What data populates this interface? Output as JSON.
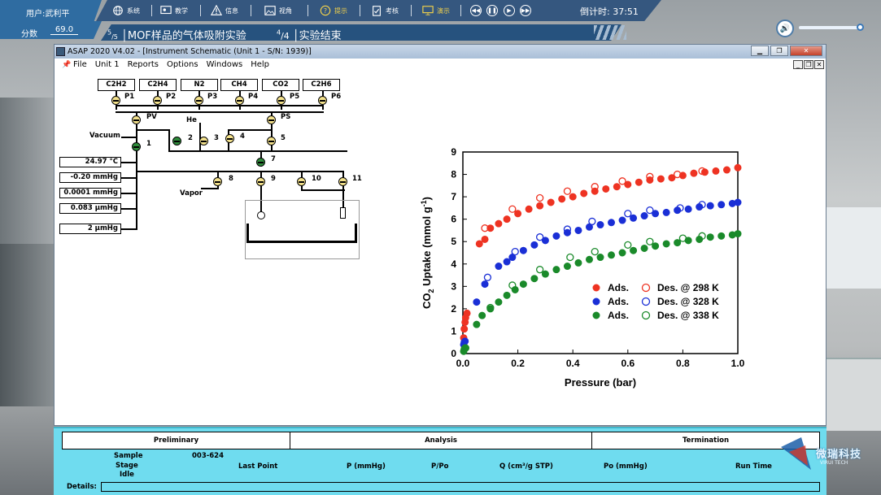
{
  "topbar": {
    "user_label": "用户:武利平",
    "score_label": "分数",
    "score_value": "69.0",
    "menu": [
      {
        "label": "系统",
        "icon": "globe-icon"
      },
      {
        "label": "教学",
        "icon": "teaching-icon"
      },
      {
        "label": "信息",
        "icon": "warning-icon"
      },
      {
        "label": "视角",
        "icon": "image-icon"
      },
      {
        "label": "提示",
        "icon": "question-icon"
      },
      {
        "label": "考核",
        "icon": "clipboard-icon"
      },
      {
        "label": "演示",
        "icon": "monitor-icon"
      }
    ],
    "timer": "倒计时: 37:51"
  },
  "steps": {
    "current_num": "5",
    "current_den": "5",
    "current_title": "MOF样品的气体吸附实验",
    "sub_num": "4",
    "sub_den": "4",
    "sub_title": "实验结束"
  },
  "window": {
    "title": "ASAP 2020 V4.02 - [Instrument Schematic (Unit 1 - S/N: 1939)]",
    "menu": [
      "File",
      "Unit 1",
      "Reports",
      "Options",
      "Windows",
      "Help"
    ]
  },
  "schematic": {
    "gases": [
      "C2H2",
      "C2H4",
      "N2",
      "CH4",
      "CO2",
      "C2H6"
    ],
    "ports": [
      "P1",
      "P2",
      "P3",
      "P4",
      "P5",
      "P6"
    ],
    "labels": {
      "pv": "PV",
      "ps": "PS",
      "he": "He",
      "vacuum": "Vacuum",
      "vapor": "Vapor",
      "v1": "1",
      "v2": "2",
      "v3": "3",
      "v4": "4",
      "v5": "5",
      "v7": "7",
      "v8": "8",
      "v9": "9",
      "v10": "10",
      "v11": "11"
    },
    "readings": [
      "24.97 °C",
      "-0.20 mmHg",
      "0.0001 mmHg",
      "0.083 µmHg",
      "2 µmHg"
    ]
  },
  "chart_data": {
    "type": "scatter",
    "xlabel": "Pressure (bar)",
    "ylabel_main": "CO",
    "ylabel_sub": "2",
    "ylabel_rest": " Uptake (mmol g",
    "ylabel_sup": "-1",
    "ylabel_end": ")",
    "xlim": [
      0,
      1.0
    ],
    "ylim": [
      0,
      9
    ],
    "xticks": [
      "0.0",
      "0.2",
      "0.4",
      "0.6",
      "0.8",
      "1.0"
    ],
    "yticks": [
      "0",
      "1",
      "2",
      "3",
      "4",
      "5",
      "6",
      "7",
      "8",
      "9"
    ],
    "legend": [
      {
        "ads": "Ads.",
        "des": "Des. @ 298 K",
        "color": "#ee3322"
      },
      {
        "ads": "Ads.",
        "des": "Des. @ 328 K",
        "color": "#1a2fd6"
      },
      {
        "ads": "Ads.",
        "des": "Des. @ 338 K",
        "color": "#1a8a2a"
      }
    ],
    "series": [
      {
        "color": "#ee3322",
        "ads": [
          [
            0.003,
            0.7
          ],
          [
            0.005,
            1.1
          ],
          [
            0.008,
            1.4
          ],
          [
            0.01,
            1.6
          ],
          [
            0.015,
            1.8
          ],
          [
            0.06,
            4.9
          ],
          [
            0.08,
            5.1
          ],
          [
            0.1,
            5.6
          ],
          [
            0.13,
            5.8
          ],
          [
            0.16,
            6.0
          ],
          [
            0.2,
            6.25
          ],
          [
            0.24,
            6.45
          ],
          [
            0.28,
            6.6
          ],
          [
            0.32,
            6.75
          ],
          [
            0.36,
            6.9
          ],
          [
            0.4,
            7.0
          ],
          [
            0.44,
            7.15
          ],
          [
            0.48,
            7.25
          ],
          [
            0.52,
            7.35
          ],
          [
            0.56,
            7.45
          ],
          [
            0.6,
            7.55
          ],
          [
            0.64,
            7.65
          ],
          [
            0.68,
            7.75
          ],
          [
            0.72,
            7.8
          ],
          [
            0.76,
            7.85
          ],
          [
            0.8,
            7.95
          ],
          [
            0.84,
            8.05
          ],
          [
            0.88,
            8.1
          ],
          [
            0.92,
            8.15
          ],
          [
            0.96,
            8.2
          ],
          [
            1.0,
            8.3
          ]
        ],
        "des": [
          [
            0.08,
            5.6
          ],
          [
            0.18,
            6.45
          ],
          [
            0.28,
            6.95
          ],
          [
            0.38,
            7.25
          ],
          [
            0.48,
            7.45
          ],
          [
            0.58,
            7.7
          ],
          [
            0.68,
            7.9
          ],
          [
            0.78,
            8.0
          ],
          [
            0.87,
            8.15
          ]
        ]
      },
      {
        "color": "#1a2fd6",
        "ads": [
          [
            0.003,
            0.4
          ],
          [
            0.005,
            0.5
          ],
          [
            0.008,
            0.55
          ],
          [
            0.05,
            2.3
          ],
          [
            0.08,
            3.1
          ],
          [
            0.13,
            3.9
          ],
          [
            0.16,
            4.1
          ],
          [
            0.18,
            4.3
          ],
          [
            0.22,
            4.6
          ],
          [
            0.26,
            4.85
          ],
          [
            0.3,
            5.05
          ],
          [
            0.34,
            5.25
          ],
          [
            0.38,
            5.4
          ],
          [
            0.42,
            5.5
          ],
          [
            0.46,
            5.65
          ],
          [
            0.5,
            5.75
          ],
          [
            0.54,
            5.85
          ],
          [
            0.58,
            5.95
          ],
          [
            0.62,
            6.05
          ],
          [
            0.66,
            6.15
          ],
          [
            0.7,
            6.25
          ],
          [
            0.74,
            6.3
          ],
          [
            0.78,
            6.4
          ],
          [
            0.82,
            6.45
          ],
          [
            0.86,
            6.55
          ],
          [
            0.9,
            6.6
          ],
          [
            0.94,
            6.65
          ],
          [
            0.98,
            6.7
          ],
          [
            1.0,
            6.75
          ]
        ],
        "des": [
          [
            0.09,
            3.4
          ],
          [
            0.19,
            4.55
          ],
          [
            0.28,
            5.2
          ],
          [
            0.38,
            5.55
          ],
          [
            0.47,
            5.9
          ],
          [
            0.6,
            6.25
          ],
          [
            0.68,
            6.4
          ],
          [
            0.79,
            6.5
          ],
          [
            0.87,
            6.65
          ]
        ]
      },
      {
        "color": "#1a8a2a",
        "ads": [
          [
            0.003,
            0.1
          ],
          [
            0.005,
            0.2
          ],
          [
            0.008,
            0.25
          ],
          [
            0.05,
            1.3
          ],
          [
            0.07,
            1.7
          ],
          [
            0.1,
            2.0
          ],
          [
            0.13,
            2.3
          ],
          [
            0.16,
            2.6
          ],
          [
            0.19,
            2.85
          ],
          [
            0.22,
            3.1
          ],
          [
            0.26,
            3.35
          ],
          [
            0.3,
            3.55
          ],
          [
            0.34,
            3.75
          ],
          [
            0.38,
            3.9
          ],
          [
            0.42,
            4.05
          ],
          [
            0.46,
            4.2
          ],
          [
            0.5,
            4.3
          ],
          [
            0.54,
            4.4
          ],
          [
            0.58,
            4.5
          ],
          [
            0.62,
            4.6
          ],
          [
            0.66,
            4.7
          ],
          [
            0.7,
            4.8
          ],
          [
            0.74,
            4.9
          ],
          [
            0.78,
            4.95
          ],
          [
            0.82,
            5.05
          ],
          [
            0.86,
            5.1
          ],
          [
            0.9,
            5.2
          ],
          [
            0.94,
            5.25
          ],
          [
            0.98,
            5.3
          ],
          [
            1.0,
            5.35
          ]
        ],
        "des": [
          [
            0.01,
            0.25
          ],
          [
            0.1,
            2.05
          ],
          [
            0.18,
            3.05
          ],
          [
            0.28,
            3.75
          ],
          [
            0.39,
            4.3
          ],
          [
            0.48,
            4.55
          ],
          [
            0.6,
            4.85
          ],
          [
            0.68,
            5.0
          ],
          [
            0.8,
            5.15
          ],
          [
            0.87,
            5.25
          ]
        ]
      }
    ]
  },
  "panel": {
    "headers": [
      "Preliminary",
      "Analysis",
      "Termination"
    ],
    "sample_label": "Sample",
    "sample_value": "003-624",
    "stage_label": "Stage",
    "stage_value": "Idle",
    "columns": [
      "Last Point",
      "P (mmHg)",
      "P/Po",
      "Q (cm³/g STP)",
      "Po (mmHg)",
      "Run Time"
    ],
    "details_label": "Details:"
  },
  "logo": {
    "text": "微瑞科技",
    "sub": "VIRUI TECH"
  }
}
